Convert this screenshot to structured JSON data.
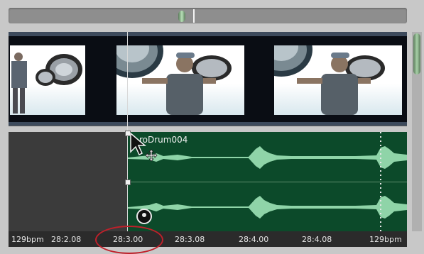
{
  "timeline": {
    "clip_name": "roDrum004",
    "ruler_labels": [
      "129bpm",
      "28:2.08",
      "28:3.00",
      "28:3.08",
      "28:4.00",
      "28:4.08",
      "129bpm"
    ],
    "highlighted_time": "28:3.00"
  },
  "icons": {
    "cursor": "arrow-cursor-icon",
    "move": "move-cross-icon",
    "sync": "sync-lock-icon"
  },
  "colors": {
    "audio_clip": "#0c4a2a",
    "waveform": "#8fd4a8",
    "highlight_ellipse": "#c0202a",
    "video_track_border": "#3d4a5c"
  }
}
